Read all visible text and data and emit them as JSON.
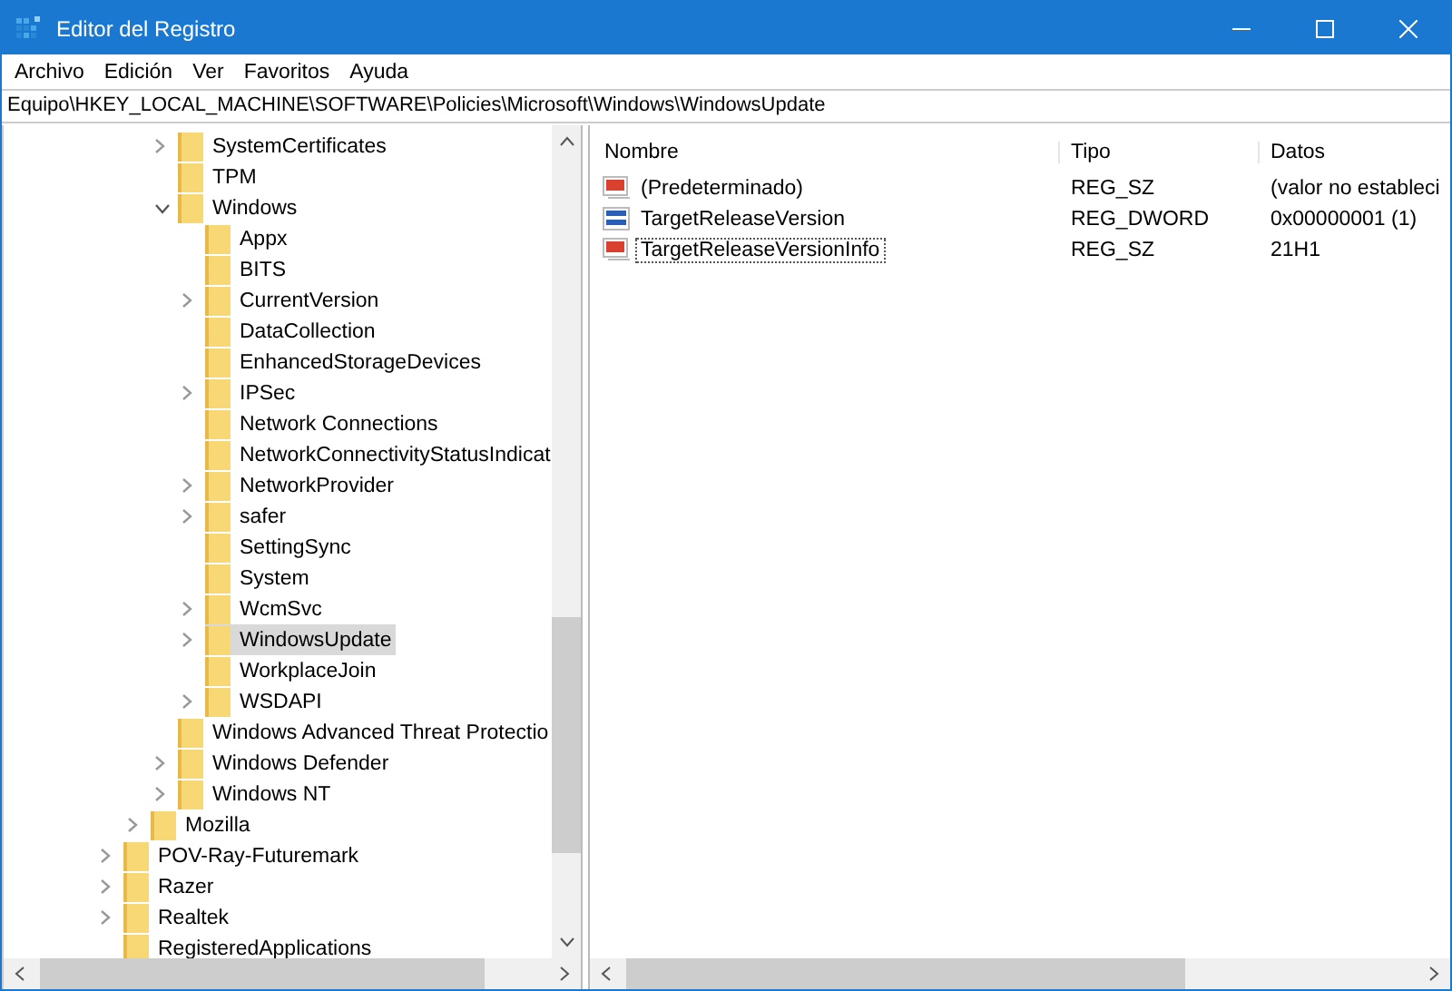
{
  "window": {
    "title": "Editor del Registro"
  },
  "menu": [
    "Archivo",
    "Edición",
    "Ver",
    "Favoritos",
    "Ayuda"
  ],
  "address": "Equipo\\HKEY_LOCAL_MACHINE\\SOFTWARE\\Policies\\Microsoft\\Windows\\WindowsUpdate",
  "tree": [
    {
      "children": [
        {
          "children": [
            {
              "label": "SystemCertificates",
              "expanded": false,
              "selected": false
            },
            {
              "label": "TPM",
              "selected": false
            },
            {
              "label": "Windows",
              "expanded": true,
              "selected": false,
              "children": [
                {
                  "label": "Appx",
                  "selected": false
                },
                {
                  "label": "BITS",
                  "selected": false
                },
                {
                  "label": "CurrentVersion",
                  "expanded": false,
                  "selected": false
                },
                {
                  "label": "DataCollection",
                  "selected": false
                },
                {
                  "label": "EnhancedStorageDevices",
                  "selected": false
                },
                {
                  "label": "IPSec",
                  "expanded": false,
                  "selected": false
                },
                {
                  "label": "Network Connections",
                  "selected": false
                },
                {
                  "label": "NetworkConnectivityStatusIndicat",
                  "selected": false
                },
                {
                  "label": "NetworkProvider",
                  "expanded": false,
                  "selected": false
                },
                {
                  "label": "safer",
                  "expanded": false,
                  "selected": false
                },
                {
                  "label": "SettingSync",
                  "selected": false
                },
                {
                  "label": "System",
                  "selected": false
                },
                {
                  "label": "WcmSvc",
                  "expanded": false,
                  "selected": false
                },
                {
                  "label": "WindowsUpdate",
                  "expanded": false,
                  "selected": true
                },
                {
                  "label": "WorkplaceJoin",
                  "selected": false
                },
                {
                  "label": "WSDAPI",
                  "expanded": false,
                  "selected": false
                }
              ]
            },
            {
              "label": "Windows Advanced Threat Protectio",
              "selected": false
            },
            {
              "label": "Windows Defender",
              "expanded": false,
              "selected": false
            },
            {
              "label": "Windows NT",
              "expanded": false,
              "selected": false
            }
          ]
        },
        {
          "label": "Mozilla",
          "expanded": false,
          "selected": false
        }
      ]
    },
    {
      "label": "POV-Ray-Futuremark",
      "expanded": false,
      "selected": false
    },
    {
      "label": "Razer",
      "expanded": false,
      "selected": false
    },
    {
      "label": "Realtek",
      "expanded": false,
      "selected": false
    },
    {
      "label": "RegisteredApplications",
      "selected": false
    }
  ],
  "columns": [
    "Nombre",
    "Tipo",
    "Datos"
  ],
  "values": [
    {
      "kind": "string",
      "name": "(Predeterminado)",
      "type": "REG_SZ",
      "data": "(valor no estableci",
      "focused": false
    },
    {
      "kind": "binary",
      "name": "TargetReleaseVersion",
      "type": "REG_DWORD",
      "data": "0x00000001 (1)",
      "focused": false
    },
    {
      "kind": "string",
      "name": "TargetReleaseVersionInfo",
      "type": "REG_SZ",
      "data": "21H1",
      "focused": true
    }
  ]
}
